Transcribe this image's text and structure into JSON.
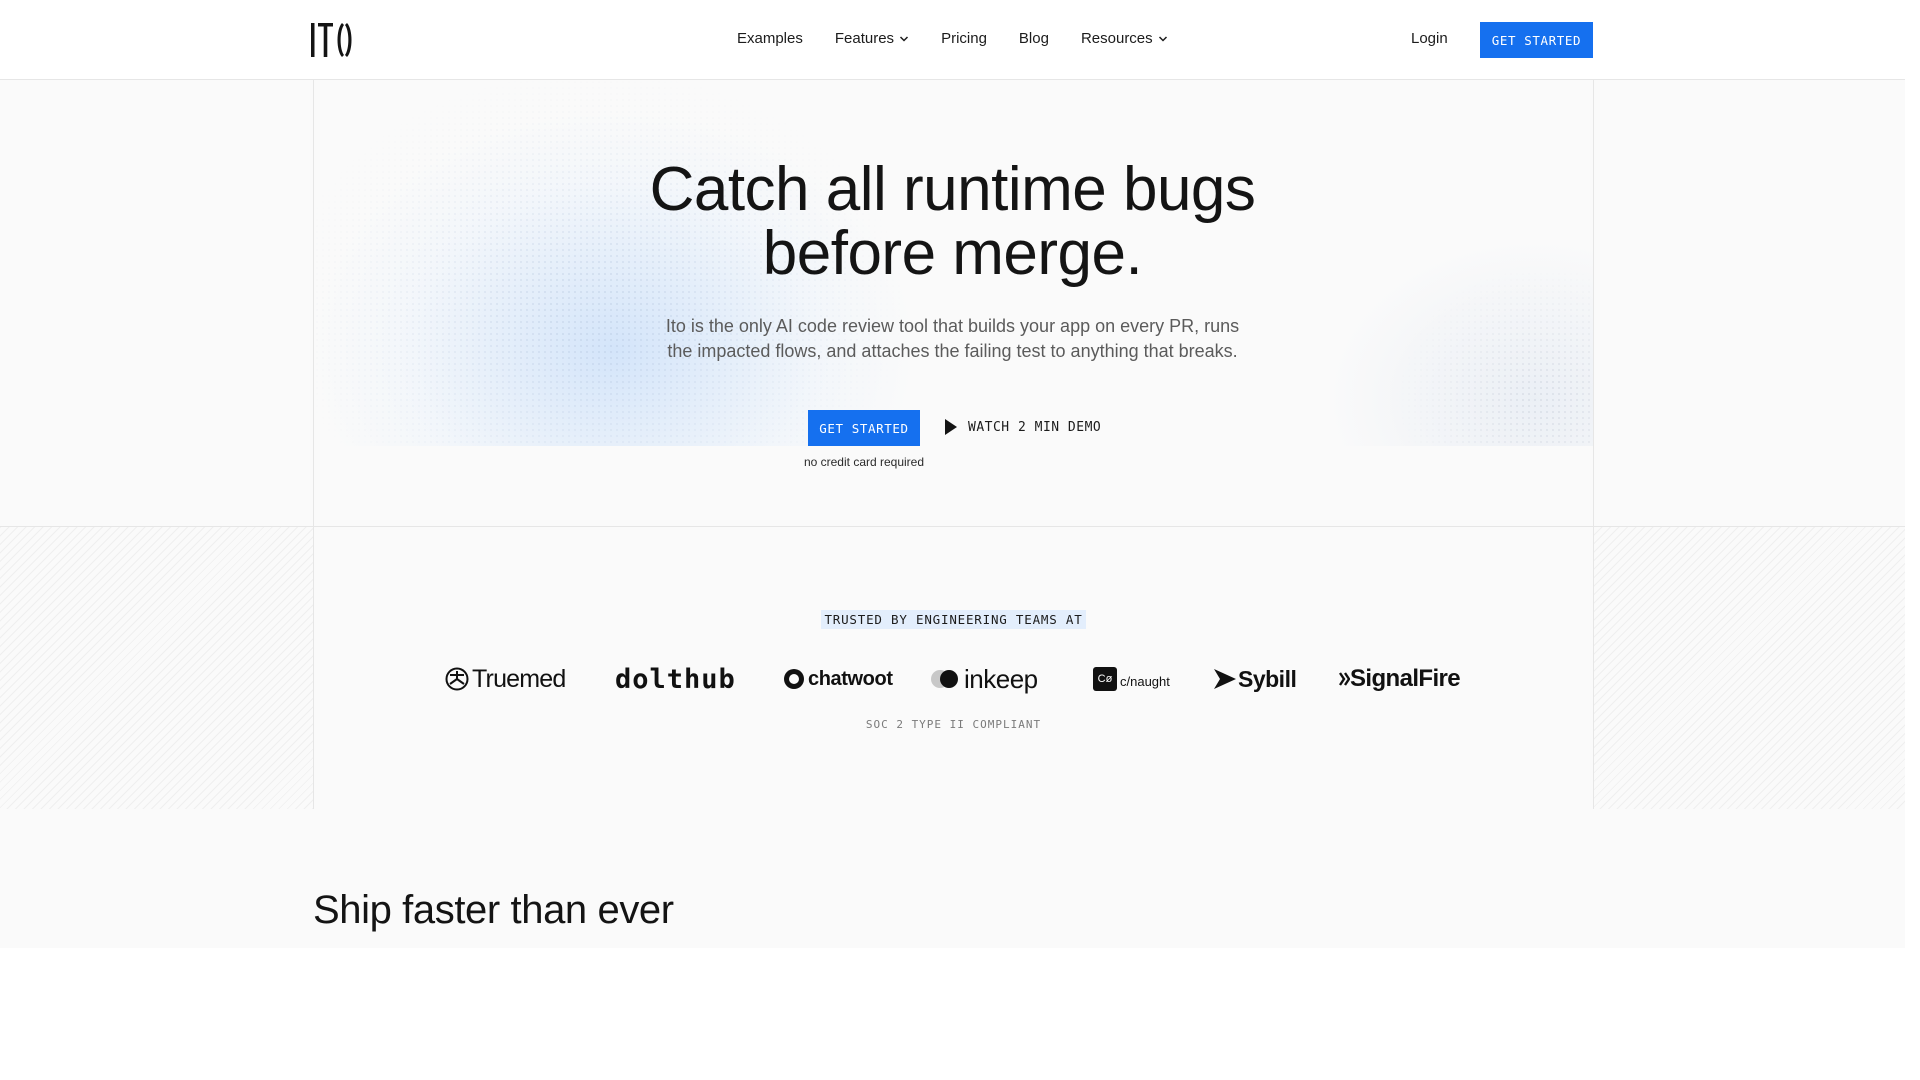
{
  "nav": {
    "logo_text": "ITO",
    "links": [
      {
        "label": "Examples",
        "dropdown": false
      },
      {
        "label": "Features",
        "dropdown": true
      },
      {
        "label": "Pricing",
        "dropdown": false
      },
      {
        "label": "Blog",
        "dropdown": false
      },
      {
        "label": "Resources",
        "dropdown": true
      }
    ],
    "login_label": "Login",
    "cta_label": "GET STARTED"
  },
  "hero": {
    "title_line1": "Catch all runtime bugs",
    "title_line2": "before merge.",
    "subtitle_line1": "Ito is the only AI code review tool that builds your app on every PR, runs",
    "subtitle_line2": "the impacted flows, and attaches the failing test to anything that breaks.",
    "cta_label": "GET STARTED",
    "demo_label": "WATCH 2 MIN DEMO",
    "note": "no credit card required"
  },
  "trusted": {
    "heading": "TRUSTED BY ENGINEERING TEAMS AT",
    "logos": [
      {
        "name": "Truemed",
        "icon": "truemed-mark"
      },
      {
        "name": "dolthub",
        "icon": "dolthub-wordmark"
      },
      {
        "name": "chatwoot",
        "icon": "chatwoot-mark"
      },
      {
        "name": "inkeep",
        "icon": "inkeep-mark"
      },
      {
        "name": "c/naught",
        "icon": "cnaught-mark",
        "badge": "Cø"
      },
      {
        "name": "Sybill",
        "icon": "sybill-mark"
      },
      {
        "name": "SignalFire",
        "icon": "signalfire-mark"
      }
    ],
    "compliance": "SOC 2 TYPE II COMPLIANT"
  },
  "ship": {
    "title": "Ship faster than ever"
  },
  "colors": {
    "accent": "#1570ef",
    "text": "#141414",
    "muted": "#5b5b5b",
    "background": "#fafafa",
    "highlight": "#e3eefc"
  }
}
